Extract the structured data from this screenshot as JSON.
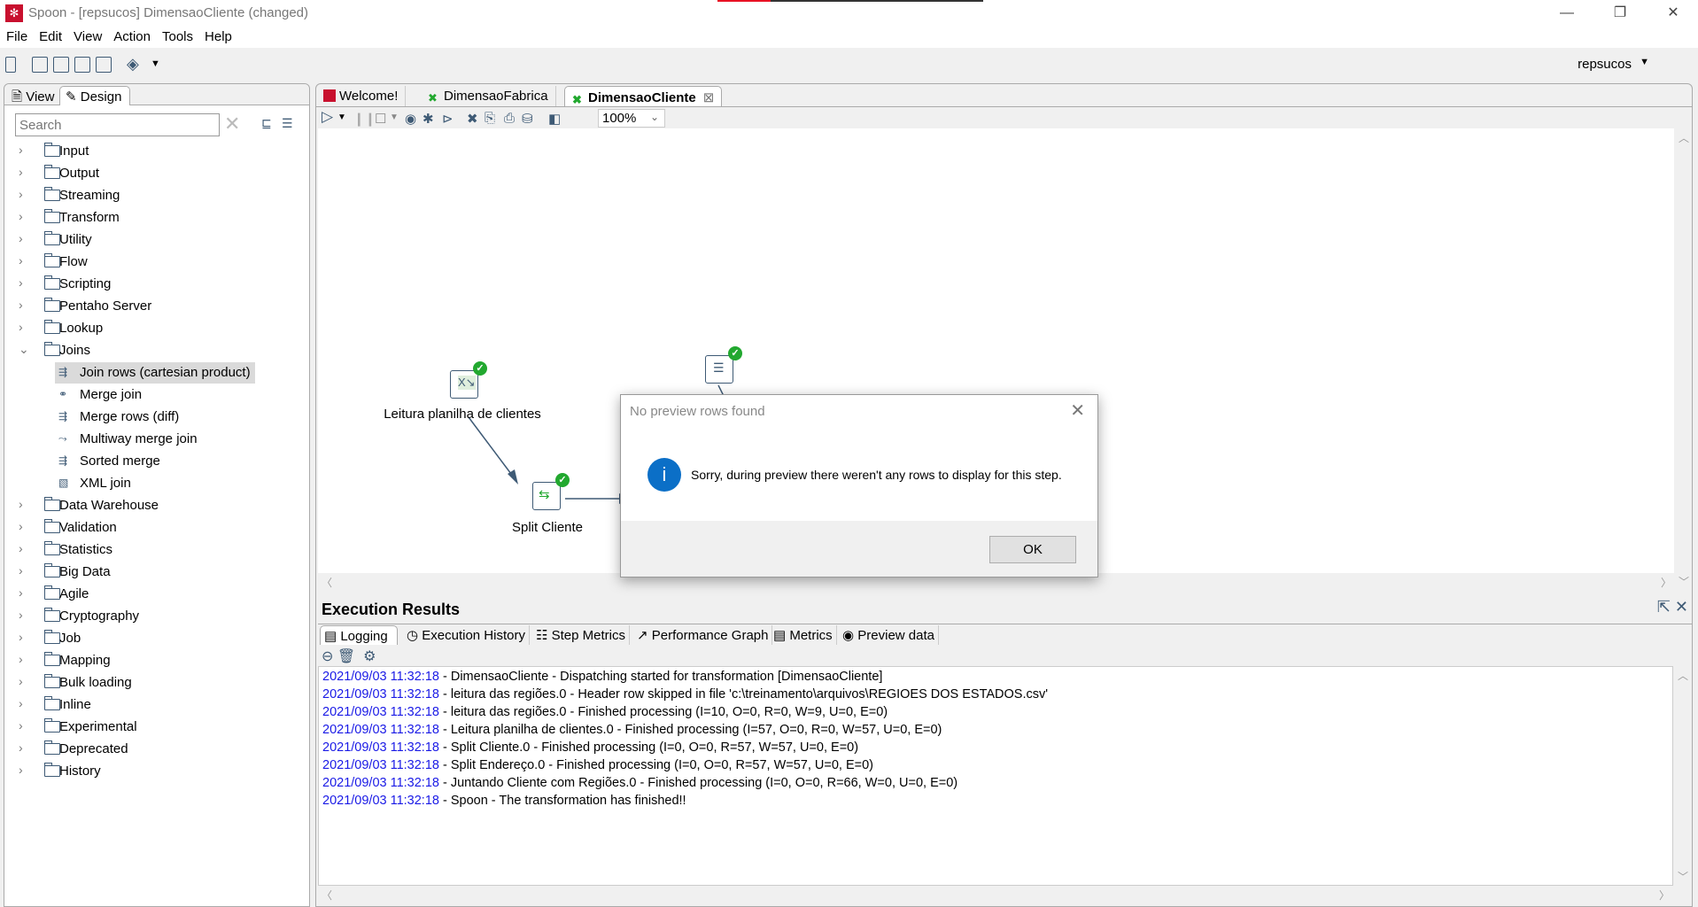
{
  "window": {
    "title": "Spoon - [repsucos] DimensaoCliente (changed)",
    "minimize": "—",
    "restore": "❐",
    "close": "✕"
  },
  "menu": [
    "File",
    "Edit",
    "View",
    "Action",
    "Tools",
    "Help"
  ],
  "toolbar": {
    "repository": "repsucos"
  },
  "left_panel": {
    "tabs": [
      "View",
      "Design"
    ],
    "search_placeholder": "Search",
    "categories": [
      "Input",
      "Output",
      "Streaming",
      "Transform",
      "Utility",
      "Flow",
      "Scripting",
      "Pentaho Server",
      "Lookup",
      "Joins"
    ],
    "joins_children": [
      "Join rows (cartesian product)",
      "Merge join",
      "Merge rows (diff)",
      "Multiway merge join",
      "Sorted merge",
      "XML join"
    ],
    "categories_after": [
      "Data Warehouse",
      "Validation",
      "Statistics",
      "Big Data",
      "Agile",
      "Cryptography",
      "Job",
      "Mapping",
      "Bulk loading",
      "Inline",
      "Experimental",
      "Deprecated",
      "History"
    ]
  },
  "editor": {
    "tabs": [
      "Welcome!",
      "DimensaoFabrica",
      "DimensaoCliente"
    ],
    "active_tab": "DimensaoCliente",
    "zoom": "100%",
    "steps": [
      {
        "label": "Leitura planilha de clientes"
      },
      {
        "label": "Split Cliente"
      },
      {
        "label": ""
      }
    ]
  },
  "dialog": {
    "title": "No preview rows found",
    "message": "Sorry, during preview there weren't any rows to display for this step.",
    "ok": "OK"
  },
  "execution": {
    "title": "Execution Results",
    "tabs": [
      "Logging",
      "Execution History",
      "Step Metrics",
      "Performance Graph",
      "Metrics",
      "Preview data"
    ],
    "log": [
      {
        "ts": "2021/09/03 11:32:18",
        "msg": " - DimensaoCliente - Dispatching started for transformation [DimensaoCliente]"
      },
      {
        "ts": "2021/09/03 11:32:18",
        "msg": " - leitura das regiões.0 - Header row skipped in file 'c:\\treinamento\\arquivos\\REGIOES DOS ESTADOS.csv'"
      },
      {
        "ts": "2021/09/03 11:32:18",
        "msg": " - leitura das regiões.0 - Finished processing (I=10, O=0, R=0, W=9, U=0, E=0)"
      },
      {
        "ts": "2021/09/03 11:32:18",
        "msg": " - Leitura planilha de clientes.0 - Finished processing (I=57, O=0, R=0, W=57, U=0, E=0)"
      },
      {
        "ts": "2021/09/03 11:32:18",
        "msg": " - Split Cliente.0 - Finished processing (I=0, O=0, R=57, W=57, U=0, E=0)"
      },
      {
        "ts": "2021/09/03 11:32:18",
        "msg": " - Split Endereço.0 - Finished processing (I=0, O=0, R=57, W=57, U=0, E=0)"
      },
      {
        "ts": "2021/09/03 11:32:18",
        "msg": " - Juntando Cliente com Regiões.0 - Finished processing (I=0, O=0, R=66, W=0, U=0, E=0)"
      },
      {
        "ts": "2021/09/03 11:32:18",
        "msg": " - Spoon - The transformation has finished!!"
      }
    ]
  },
  "colors": {
    "accent": "#3e5a75",
    "timestamp": "#1a1ae6",
    "success": "#22a82f",
    "info": "#0b6fc7",
    "brand": "#c8102e"
  }
}
